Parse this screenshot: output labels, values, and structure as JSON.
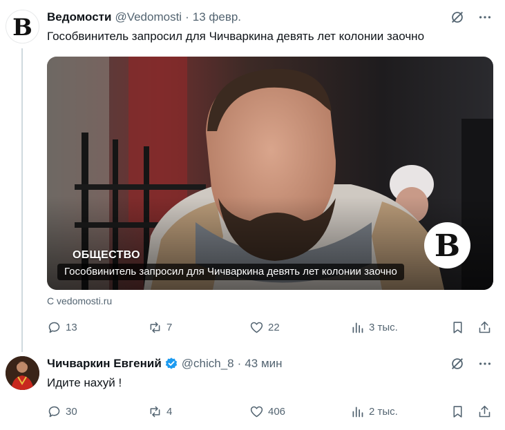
{
  "tweets": [
    {
      "author": "Ведомости",
      "handle": "@Vedomosti",
      "time": "13 февр.",
      "avatar_letter": "B",
      "text": "Гособвинитель запросил для Чичваркина девять лет колонии заочно",
      "card": {
        "category": "ОБЩЕСТВО",
        "caption": "Гособвинитель запросил для Чичваркина девять лет колонии заочно",
        "logo_letter": "B",
        "source": "С vedomosti.ru"
      },
      "stats": {
        "replies": "13",
        "reposts": "7",
        "likes": "22",
        "views": "3 тыс."
      }
    },
    {
      "author": "Чичваркин Евгений",
      "handle": "@chich_8",
      "time": "43 мин",
      "verified": true,
      "text": "Идите нахуй !",
      "stats": {
        "replies": "30",
        "reposts": "4",
        "likes": "406",
        "views": "2 тыс."
      }
    }
  ],
  "colors": {
    "text": "#0f1419",
    "muted": "#536471",
    "verified_blue": "#1d9bf0",
    "thread_line": "#cfd9de"
  },
  "icons": [
    "grok-icon",
    "more-icon",
    "reply-icon",
    "repost-icon",
    "like-icon",
    "views-icon",
    "bookmark-icon",
    "share-icon",
    "verified-icon"
  ]
}
